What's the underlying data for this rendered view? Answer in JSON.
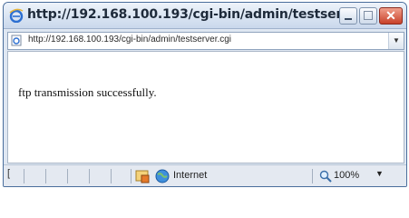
{
  "window": {
    "title": "http://192.168.100.193/cgi-bin/admin/testser..."
  },
  "address": {
    "url": "http://192.168.100.193/cgi-bin/admin/testserver.cgi"
  },
  "content": {
    "message": "ftp transmission successfully."
  },
  "statusbar": {
    "left_text": "[",
    "zone": "Internet",
    "zoom": "100%"
  },
  "colors": {
    "close_button": "#c8412a",
    "title_text": "#1e2a3a",
    "chrome": "#dfe7f2"
  }
}
